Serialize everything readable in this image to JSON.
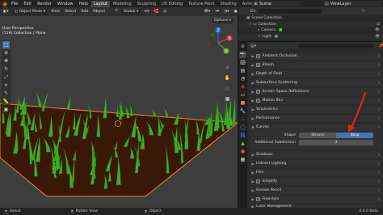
{
  "topbar": {
    "menus": [
      "File",
      "Edit",
      "Render",
      "Window",
      "Help"
    ],
    "workspaces": [
      "Layout",
      "Modeling",
      "Sculpting",
      "UV Editing",
      "Texture Paint",
      "Shading",
      "Animation"
    ],
    "active_workspace": "Layout",
    "scene": "Scene",
    "view_layer": "ViewLayer"
  },
  "viewport_header": {
    "mode": "Object Mode",
    "menus": [
      "View",
      "Select",
      "Add",
      "Object"
    ],
    "transform_orientation": "Global",
    "options_label": "Options"
  },
  "viewport": {
    "perspective": "User Perspective",
    "collection_info": "(119) Collection | Plane"
  },
  "outliner": {
    "scene_collection": "Scene Collection",
    "items": [
      {
        "label": "Collection",
        "level": 1,
        "icon": "collection-icon"
      },
      {
        "label": "Camera",
        "level": 2,
        "icon": "camera-icon"
      },
      {
        "label": "Light",
        "level": 2,
        "icon": "light-icon"
      }
    ]
  },
  "properties": {
    "panels_top": [
      {
        "label": "Ambient Occlusion",
        "checkbox": true
      },
      {
        "label": "Bloom",
        "checkbox": true
      },
      {
        "label": "Depth of Field",
        "checkbox": false
      },
      {
        "label": "Subsurface Scattering",
        "checkbox": false
      },
      {
        "label": "Screen Space Reflections",
        "checkbox": true
      },
      {
        "label": "Motion Blur",
        "checkbox": true
      },
      {
        "label": "Volumetrics",
        "checkbox": false
      },
      {
        "label": "Performance",
        "checkbox": false
      }
    ],
    "curves": {
      "label": "Curves",
      "shape_label": "Shape",
      "shape_options": [
        "Strand",
        "Strip"
      ],
      "shape_selected": "Strip",
      "subdivision_label": "Additional Subdivision",
      "subdivision_value": "3"
    },
    "panels_bottom": [
      {
        "label": "Shadows",
        "checkbox": false
      },
      {
        "label": "Indirect Lighting",
        "checkbox": false
      },
      {
        "label": "Film",
        "checkbox": false
      },
      {
        "label": "Simplify",
        "checkbox": true
      },
      {
        "label": "Grease Pencil",
        "checkbox": false
      },
      {
        "label": "Freestyle",
        "checkbox": true
      },
      {
        "label": "Color Management",
        "checkbox": false
      }
    ]
  },
  "statusbar": {
    "select": "Select",
    "rotate": "Rotate View",
    "object": "Object",
    "version": "4.0.0 Beta"
  },
  "colors": {
    "accent_blue": "#4772b3",
    "annotation_red": "#e02020",
    "ground_fill": "#3a1808",
    "selection_outline": "#f08a20"
  }
}
